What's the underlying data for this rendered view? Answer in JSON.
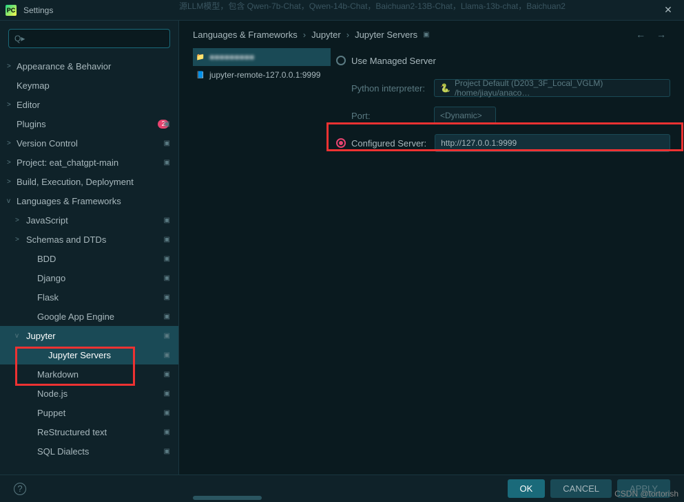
{
  "window": {
    "title": "Settings"
  },
  "background_text": "源LLM模型，包含 Qwen-7b-Chat，Qwen-14b-Chat，Baichuan2-13B-Chat，Llama-13b-chat，Baichuan2",
  "search": {
    "placeholder": "Q▸"
  },
  "sidebar": {
    "items": [
      {
        "id": "appearance",
        "label": "Appearance & Behavior",
        "arrow": ">"
      },
      {
        "id": "keymap",
        "label": "Keymap"
      },
      {
        "id": "editor",
        "label": "Editor",
        "arrow": ">"
      },
      {
        "id": "plugins",
        "label": "Plugins",
        "badge": "2",
        "ind": "▣"
      },
      {
        "id": "vcs",
        "label": "Version Control",
        "arrow": ">",
        "ind": "▣"
      },
      {
        "id": "project",
        "label": "Project: eat_chatgpt-main",
        "arrow": ">",
        "ind": "▣"
      },
      {
        "id": "build",
        "label": "Build, Execution, Deployment",
        "arrow": ">"
      },
      {
        "id": "langfw",
        "label": "Languages & Frameworks",
        "arrow": "v"
      }
    ],
    "sub": [
      {
        "id": "js",
        "label": "JavaScript",
        "arrow": ">",
        "ind": "▣"
      },
      {
        "id": "schemas",
        "label": "Schemas and DTDs",
        "arrow": ">",
        "ind": "▣"
      },
      {
        "id": "bdd",
        "label": "BDD",
        "ind": "▣"
      },
      {
        "id": "django",
        "label": "Django",
        "ind": "▣"
      },
      {
        "id": "flask",
        "label": "Flask",
        "ind": "▣"
      },
      {
        "id": "gae",
        "label": "Google App Engine",
        "ind": "▣"
      },
      {
        "id": "jupyter",
        "label": "Jupyter",
        "arrow": "v",
        "ind": "▣"
      },
      {
        "id": "jupyter-servers",
        "label": "Jupyter Servers",
        "ind": "▣",
        "level": 3
      },
      {
        "id": "markdown",
        "label": "Markdown",
        "ind": "▣"
      },
      {
        "id": "nodejs",
        "label": "Node.js",
        "ind": "▣"
      },
      {
        "id": "puppet",
        "label": "Puppet",
        "ind": "▣"
      },
      {
        "id": "rst",
        "label": "ReStructured text",
        "ind": "▣"
      },
      {
        "id": "sql",
        "label": "SQL Dialects",
        "ind": "▣"
      }
    ]
  },
  "breadcrumb": {
    "a": "Languages & Frameworks",
    "b": "Jupyter",
    "c": "Jupyter Servers",
    "ind": "▣"
  },
  "files": [
    {
      "label": "■■■■■■■■■",
      "blur": true
    },
    {
      "label": "jupyter-remote-127.0.0.1:9999"
    }
  ],
  "form": {
    "managed_label": "Use Managed Server",
    "interpreter_label": "Python interpreter:",
    "interpreter_value": "Project Default (D203_3F_Local_VGLM) /home/jiayu/anaco…",
    "port_label": "Port:",
    "port_value": "<Dynamic>",
    "configured_label": "Configured Server:",
    "configured_value": "http://127.0.0.1:9999"
  },
  "buttons": {
    "ok": "OK",
    "cancel": "CANCEL",
    "apply": "APPLY"
  },
  "watermark": "CSDN @tortorish"
}
